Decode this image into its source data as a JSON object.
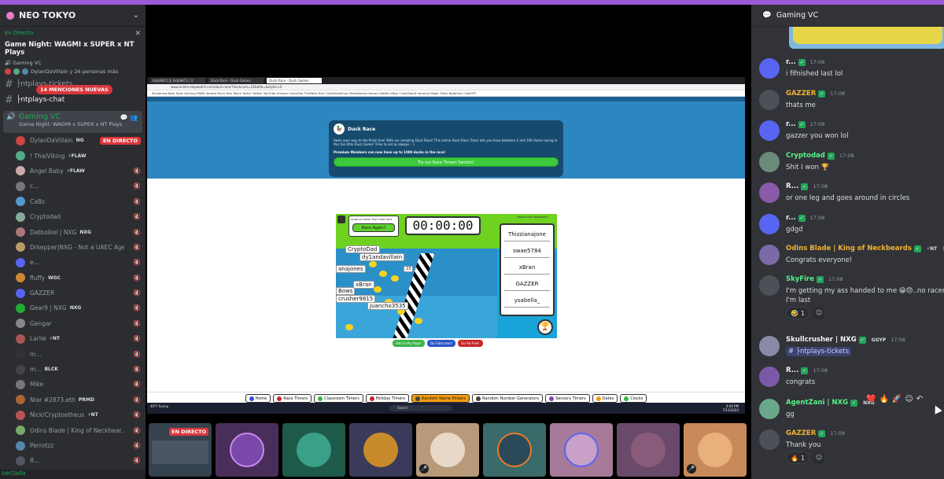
{
  "server": {
    "name": "NEO TOKYO"
  },
  "live": {
    "label": "En Directo",
    "title": "Game Night: WAGMI x SUPER x NT Plays",
    "channel": "Gaming VC",
    "viewers": "DylanDaVillain y 26 personas más"
  },
  "channels": {
    "tickets": "├ntplays-tickets",
    "chat": "├ntplays-chat",
    "mentions_badge": "14 MENCIONES NUEVAS"
  },
  "voice": {
    "name": "Gaming VC",
    "sub": "Game Night: WAGMI x SUPER x NT Plays",
    "users": [
      {
        "name": "DylanDaVillain",
        "tag": "NG",
        "badge": "EN DIRECTO",
        "color": "#c44"
      },
      {
        "name": "! ThaiViking",
        "tag": "⚡FLAW",
        "color": "#5a8"
      },
      {
        "name": "Angel Baby",
        "tag": "⚡FLAW",
        "color": "#caa"
      },
      {
        "name": "c...",
        "tag": "",
        "color": "#777"
      },
      {
        "name": "CaBs",
        "tag": "",
        "color": "#59c"
      },
      {
        "name": "Cryptodad",
        "tag": "",
        "color": "#8a9"
      },
      {
        "name": "Datboikel | NXG",
        "tag": "NXG",
        "color": "#a77"
      },
      {
        "name": "Drkepper|NXG - Not a UAEC Agent",
        "tag": "",
        "color": "#b96"
      },
      {
        "name": "e...",
        "tag": "",
        "color": "#5865f2"
      },
      {
        "name": "fluffy",
        "tag": "WGC",
        "color": "#c83"
      },
      {
        "name": "GAZZER",
        "tag": "",
        "color": "#5865f2"
      },
      {
        "name": "Gear9 | NXG",
        "tag": "NXG",
        "color": "#2a3"
      },
      {
        "name": "Gengar",
        "tag": "",
        "color": "#888"
      },
      {
        "name": "Larlie",
        "tag": "⚡NT",
        "color": "#a55"
      },
      {
        "name": "m...",
        "tag": "",
        "color": "#333"
      },
      {
        "name": "m...",
        "tag": "BLCK",
        "color": "#444"
      },
      {
        "name": "Mike",
        "tag": "",
        "color": "#777"
      },
      {
        "name": "Niar #2873.eth",
        "tag": "PRMD",
        "color": "#a63"
      },
      {
        "name": "Nick/Cryptoetheus",
        "tag": "⚡NT",
        "color": "#b55"
      },
      {
        "name": "Odins Blade | King of Neckbear...",
        "tag": "",
        "color": "#7a6"
      },
      {
        "name": "Perrotzz",
        "tag": "",
        "color": "#58a"
      },
      {
        "name": "R...",
        "tag": "",
        "color": "#556"
      }
    ]
  },
  "footer": {
    "status": "nectada"
  },
  "browser": {
    "tabs": [
      "Kxfp9872 ||| Kxfp9872 | X",
      "Duck Race - Duck Games",
      "Duck Race - Duck Games"
    ],
    "url": "www.online-stopwatch.com/duck-race/?ducknum=10&title=&styler=0",
    "bookmarks": "Streaming Bots   Tools   Gaming   NSBK related   Mycn   Neo Tokyo   Twitch   Twitter   YouTube   Amazon   OpenSea   TireMeAs Blur   CoinMarketCap   Marketplace   Karanu   Netflix   eBay   CrackSpedt   Ironema   Magic Eden   NodeOps   ChatGPT"
  },
  "promo": {
    "title": "Duck Race",
    "text": "Swim your way to the finish line! With our amazing Duck Race! This online Duck Race Timer lets you have between 2 and 100 ducks racing in this fun little Duck Game! Time to set as always - :)",
    "premium": "Premium Members can now have up to 1000 ducks in the race!",
    "button": "Try our Race Timers Section!"
  },
  "game": {
    "timer": "00:00:00",
    "race_prompt": "Autorun swear from next race",
    "race_again": "Race Again?",
    "leaderboard_title": "www.online-stopwatch",
    "leaderboard": [
      "Thizzianajone",
      "swae5784",
      "xBran",
      "GAZZER",
      "ysabella_"
    ],
    "duck_labels": [
      "CryptoDad",
      "dy1andavillain",
      "anajones",
      "xBran",
      "crusher9815",
      "Juancho3535",
      "Bows",
      "23"
    ],
    "buttons": [
      "Add to My Page!",
      "Go Fullscreen!",
      "Go Ad Free!"
    ]
  },
  "site_nav": [
    "Home",
    "Race Timers",
    "Classroom Timers",
    "Holiday Timers",
    "Random Name Pickers",
    "Random Number Generators",
    "Sensory Timers",
    "Dates",
    "Clocks"
  ],
  "taskbar": {
    "search": "Search",
    "time": "4:09 PM",
    "date": "7/13/2024",
    "app": "40°F Sunny"
  },
  "stream_live": "EN DIRECTO",
  "chat": {
    "channel": "Gaming VC",
    "messages": [
      {
        "name": "r...",
        "time": "17:08",
        "text": "i fifnished last lol",
        "color": "#f2f3f5"
      },
      {
        "name": "GAZZER",
        "time": "17:08",
        "text": "thats me",
        "color": "#f0b232"
      },
      {
        "name": "r...",
        "time": "17:08",
        "text": "gazzer you won lol",
        "color": "#f2f3f5"
      },
      {
        "name": "Cryptodad",
        "time": "17:08",
        "text": "Shit I won 🏆",
        "color": "#57f287"
      },
      {
        "name": "R...",
        "time": "17:08",
        "text": "or one leg and goes around in circles",
        "color": "#f2f3f5"
      },
      {
        "name": "r...",
        "time": "17:08",
        "text": "gdgd",
        "color": "#f2f3f5"
      },
      {
        "name": "Odins Blade | King of Neckbeards",
        "tag": "⚡NT",
        "time": "17:08",
        "text": "Congrats everyone!",
        "color": "#f0b232"
      },
      {
        "name": "SkyFire",
        "time": "17:08",
        "text": "I'm getting my ass handed to me 😁😞..no racen",
        "text2": "I'm last",
        "color": "#57f287"
      },
      {
        "name": "Skullcrusher | NXG",
        "tag": "GGYP",
        "time": "17:08",
        "text": "# ├ntplays-tickets",
        "color": "#f2f3f5"
      },
      {
        "name": "R...",
        "time": "17:08",
        "text": "congrats",
        "color": "#f2f3f5"
      },
      {
        "name": "AgentZani | NXG",
        "tag": "NXG",
        "time": "",
        "text": "gg",
        "color": "#57f287"
      },
      {
        "name": "GAZZER",
        "time": "17:09",
        "text": "Thank you",
        "color": "#f0b232"
      }
    ],
    "reactions": {
      "skyfire": "1",
      "gazzer": "1"
    }
  }
}
